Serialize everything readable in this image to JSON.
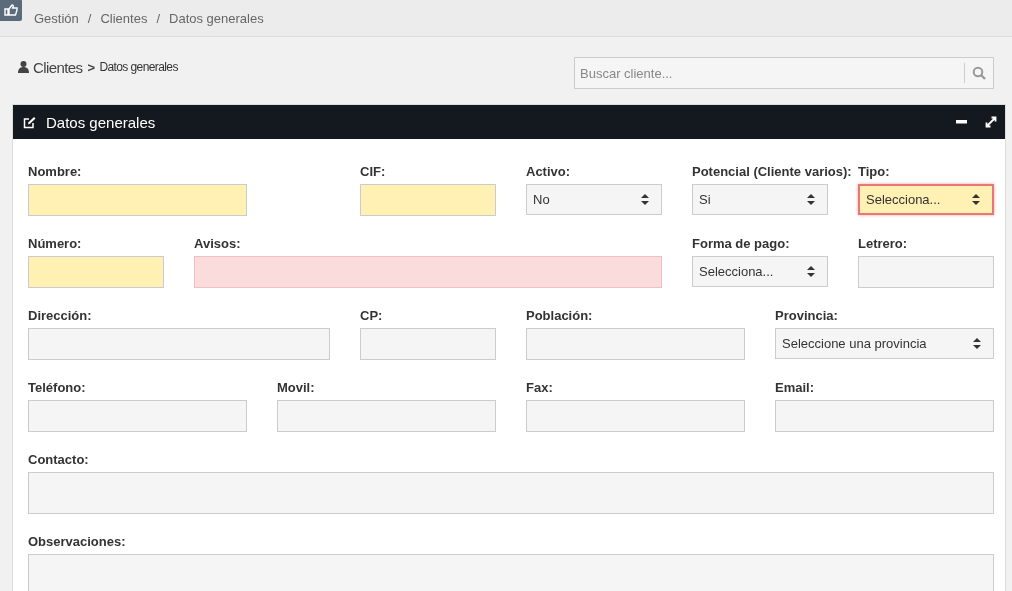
{
  "top_bar": {
    "separator": "/",
    "breadcrumb": [
      "Gestión",
      "Clientes",
      "Datos generales"
    ]
  },
  "page_heading": {
    "section": "Clientes",
    "separator": ">",
    "current": "Datos generales"
  },
  "search": {
    "placeholder": "Buscar cliente..."
  },
  "panel": {
    "title": "Datos generales",
    "rows": [
      [
        {
          "label": "Nombre:",
          "kind": "input",
          "required": true,
          "alert": false,
          "invalid": false
        },
        {
          "label": "CIF:",
          "kind": "input",
          "required": true,
          "alert": false,
          "invalid": false
        },
        {
          "label": "Activo:",
          "kind": "select",
          "value": "No",
          "required": false,
          "alert": false,
          "invalid": false
        },
        {
          "label": "Potencial (Cliente varios):",
          "kind": "select",
          "value": "Si",
          "required": false,
          "alert": false,
          "invalid": false
        },
        {
          "label": "Tipo:",
          "kind": "select",
          "value": "Selecciona...",
          "required": true,
          "alert": false,
          "invalid": true
        }
      ],
      [
        {
          "label": "Número:",
          "kind": "input",
          "required": true,
          "alert": false,
          "invalid": false
        },
        {
          "label": "Avisos:",
          "kind": "input",
          "required": false,
          "alert": true,
          "invalid": false
        },
        {
          "label": "Forma de pago:",
          "kind": "select",
          "value": "Selecciona...",
          "required": false,
          "alert": false,
          "invalid": false
        },
        {
          "label": "Letrero:",
          "kind": "input",
          "required": false,
          "alert": false,
          "invalid": false
        }
      ],
      [
        {
          "label": "Dirección:",
          "kind": "input",
          "required": false,
          "alert": false,
          "invalid": false
        },
        {
          "label": "CP:",
          "kind": "input",
          "required": false,
          "alert": false,
          "invalid": false
        },
        {
          "label": "Población:",
          "kind": "input",
          "required": false,
          "alert": false,
          "invalid": false
        },
        {
          "label": "Provincia:",
          "kind": "select",
          "value": "Seleccione una provincia",
          "required": false,
          "alert": false,
          "invalid": false
        }
      ],
      [
        {
          "label": "Teléfono:",
          "kind": "input",
          "required": false,
          "alert": false,
          "invalid": false
        },
        {
          "label": "Movil:",
          "kind": "input",
          "required": false,
          "alert": false,
          "invalid": false
        },
        {
          "label": "Fax:",
          "kind": "input",
          "required": false,
          "alert": false,
          "invalid": false
        },
        {
          "label": "Email:",
          "kind": "input",
          "required": false,
          "alert": false,
          "invalid": false
        }
      ],
      [
        {
          "label": "Contacto:",
          "kind": "input",
          "required": false,
          "alert": false,
          "invalid": false
        }
      ],
      [
        {
          "label": "Observaciones:",
          "kind": "textarea",
          "required": false,
          "alert": false,
          "invalid": false
        }
      ]
    ]
  }
}
